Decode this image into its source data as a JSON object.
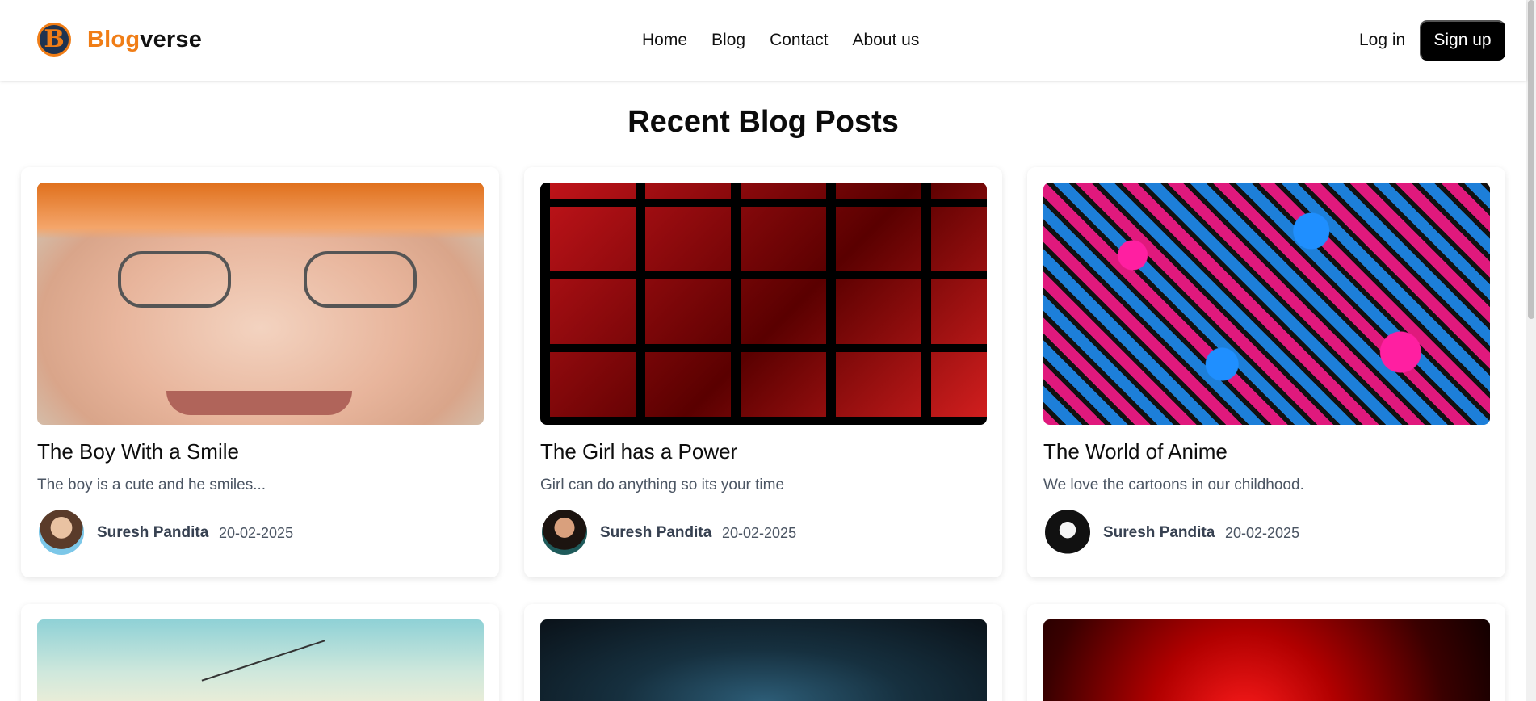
{
  "brand": {
    "logo_letter": "B",
    "name_part1": "Blog",
    "name_part2": "verse",
    "accent_color": "#f07d16"
  },
  "nav": {
    "items": [
      "Home",
      "Blog",
      "Contact",
      "About us"
    ]
  },
  "auth": {
    "login_label": "Log in",
    "signup_label": "Sign up"
  },
  "section": {
    "title": "Recent Blog Posts"
  },
  "posts": [
    {
      "title": "The Boy With a Smile",
      "excerpt": "The boy is a cute and he smiles...",
      "author": "Suresh Pandita",
      "date": "20-02-2025"
    },
    {
      "title": "The Girl has a Power",
      "excerpt": "Girl can do anything so its your time",
      "author": "Suresh Pandita",
      "date": "20-02-2025"
    },
    {
      "title": "The World of Anime",
      "excerpt": "We love the cartoons in our childhood.",
      "author": "Suresh Pandita",
      "date": "20-02-2025"
    }
  ]
}
